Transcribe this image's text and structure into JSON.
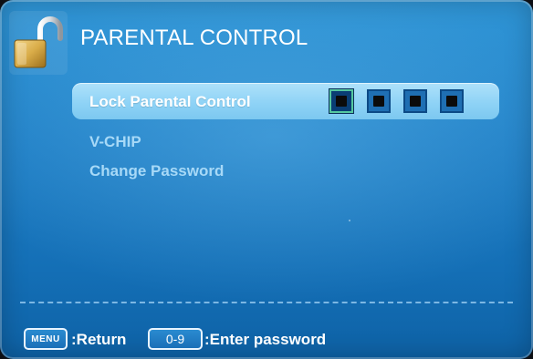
{
  "header": {
    "title": "PARENTAL CONTROL",
    "icon": "open-padlock-icon"
  },
  "menu": {
    "items": [
      {
        "label": "Lock Parental Control",
        "selected": true
      },
      {
        "label": "V-CHIP",
        "selected": false
      },
      {
        "label": "Change Password",
        "selected": false
      }
    ],
    "password_slots": 4,
    "password_filled": 4,
    "active_slot": 1
  },
  "footer": {
    "menu_key": "MENU",
    "menu_hint": ":Return",
    "num_key": "0-9",
    "num_hint": ":Enter password"
  },
  "colors": {
    "background": "#1f7fc6",
    "selected_row": "#8fd3f6",
    "inactive_text": "#a7d9f7"
  }
}
